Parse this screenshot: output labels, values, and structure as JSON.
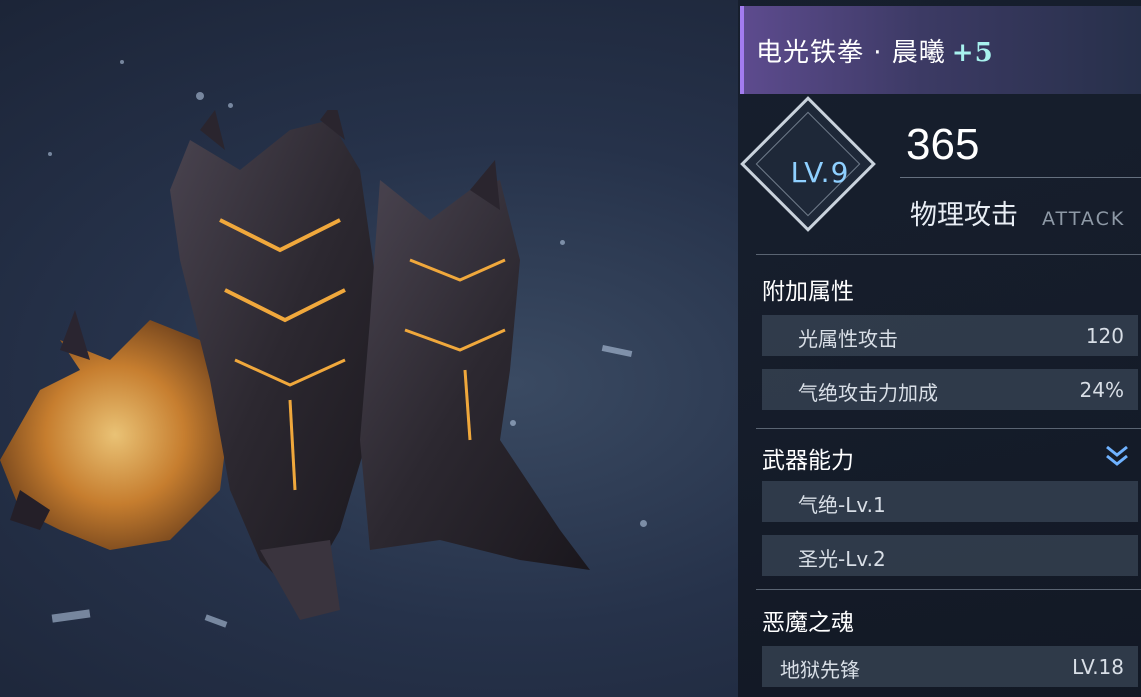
{
  "weapon": {
    "name": "电光铁拳 · 晨曦",
    "plus": "+5",
    "level": "LV.9",
    "attack_value": "365",
    "attack_label": "物理攻击",
    "attack_label_en": "ATTACK"
  },
  "bonus": {
    "title": "附加属性",
    "items": [
      {
        "name": "光属性攻击",
        "value": "120"
      },
      {
        "name": "气绝攻击力加成",
        "value": "24%"
      }
    ]
  },
  "abilities": {
    "title": "武器能力",
    "items": [
      {
        "name": "气绝-Lv.1"
      },
      {
        "name": "圣光-Lv.2"
      }
    ]
  },
  "soul": {
    "title": "恶魔之魂",
    "items": [
      {
        "name": "地狱先锋",
        "value": "LV.18"
      }
    ]
  },
  "icons": {
    "expand": "chevron-double-down-icon"
  },
  "colors": {
    "title_accent": "#a37cf0",
    "level_text": "#8fd0ff",
    "plus_text": "#a8f2ee",
    "weapon_glow": "#f0a83c"
  }
}
